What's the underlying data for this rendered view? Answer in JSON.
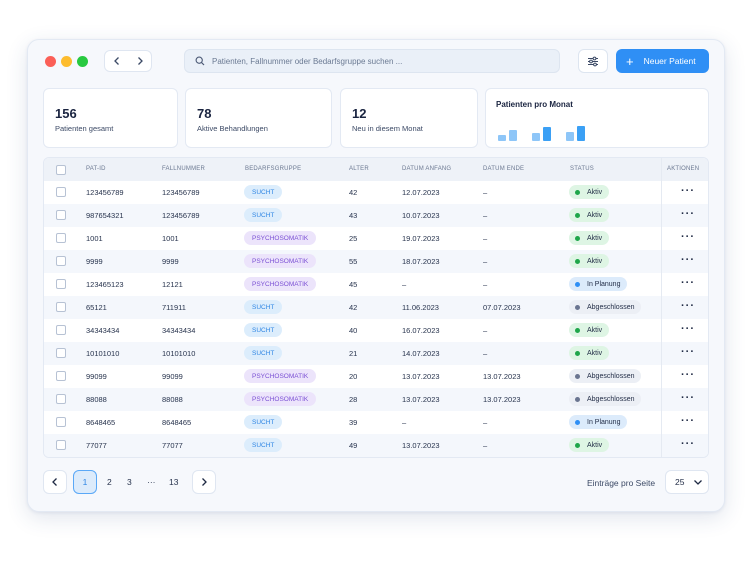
{
  "toolbar": {
    "search_placeholder": "Patienten, Fallnummer oder Bedarfsgruppe suchen ...",
    "new_patient_label": "Neuer Patient",
    "accent_color": "#2f8ff5"
  },
  "stats": [
    {
      "value": "156",
      "label": "Patienten gesamt"
    },
    {
      "value": "78",
      "label": "Aktive Behandlungen"
    },
    {
      "value": "12",
      "label": "Neu in diesem Monat"
    }
  ],
  "chart_card": {
    "title": "Patienten pro Monat"
  },
  "table": {
    "headers": [
      "PAT-ID",
      "FALLNUMMER",
      "BEDARFSGRUPPE",
      "ALTER",
      "DATUM ANFANG",
      "DATUM ENDE",
      "STATUS",
      "AKTIONEN"
    ],
    "rows": [
      {
        "id": "123456789",
        "fall": "123456789",
        "gruppe": "SUCHT",
        "alter": "42",
        "anfang": "12.07.2023",
        "ende": "–",
        "status": "Aktiv"
      },
      {
        "id": "987654321",
        "fall": "123456789",
        "gruppe": "SUCHT",
        "alter": "43",
        "anfang": "10.07.2023",
        "ende": "–",
        "status": "Aktiv"
      },
      {
        "id": "1001",
        "fall": "1001",
        "gruppe": "PSYCHOSOMATIK",
        "alter": "25",
        "anfang": "19.07.2023",
        "ende": "–",
        "status": "Aktiv"
      },
      {
        "id": "9999",
        "fall": "9999",
        "gruppe": "PSYCHOSOMATIK",
        "alter": "55",
        "anfang": "18.07.2023",
        "ende": "–",
        "status": "Aktiv"
      },
      {
        "id": "123465123",
        "fall": "12121",
        "gruppe": "PSYCHOSOMATIK",
        "alter": "45",
        "anfang": "–",
        "ende": "–",
        "status": "In Planung"
      },
      {
        "id": "65121",
        "fall": "711911",
        "gruppe": "SUCHT",
        "alter": "42",
        "anfang": "11.06.2023",
        "ende": "07.07.2023",
        "status": "Abgeschlossen"
      },
      {
        "id": "34343434",
        "fall": "34343434",
        "gruppe": "SUCHT",
        "alter": "40",
        "anfang": "16.07.2023",
        "ende": "–",
        "status": "Aktiv"
      },
      {
        "id": "10101010",
        "fall": "10101010",
        "gruppe": "SUCHT",
        "alter": "21",
        "anfang": "14.07.2023",
        "ende": "–",
        "status": "Aktiv"
      },
      {
        "id": "99099",
        "fall": "99099",
        "gruppe": "PSYCHOSOMATIK",
        "alter": "20",
        "anfang": "13.07.2023",
        "ende": "13.07.2023",
        "status": "Abgeschlossen"
      },
      {
        "id": "88088",
        "fall": "88088",
        "gruppe": "PSYCHOSOMATIK",
        "alter": "28",
        "anfang": "13.07.2023",
        "ende": "13.07.2023",
        "status": "Abgeschlossen"
      },
      {
        "id": "8648465",
        "fall": "8648465",
        "gruppe": "SUCHT",
        "alter": "39",
        "anfang": "–",
        "ende": "–",
        "status": "In Planung"
      },
      {
        "id": "77077",
        "fall": "77077",
        "gruppe": "SUCHT",
        "alter": "49",
        "anfang": "13.07.2023",
        "ende": "–",
        "status": "Aktiv"
      }
    ]
  },
  "pagination": {
    "current": "1",
    "pages": [
      "2",
      "3"
    ],
    "ellipsis": "···",
    "last": "13",
    "per_page_label": "Einträge pro Seite",
    "per_page_value": "25"
  }
}
